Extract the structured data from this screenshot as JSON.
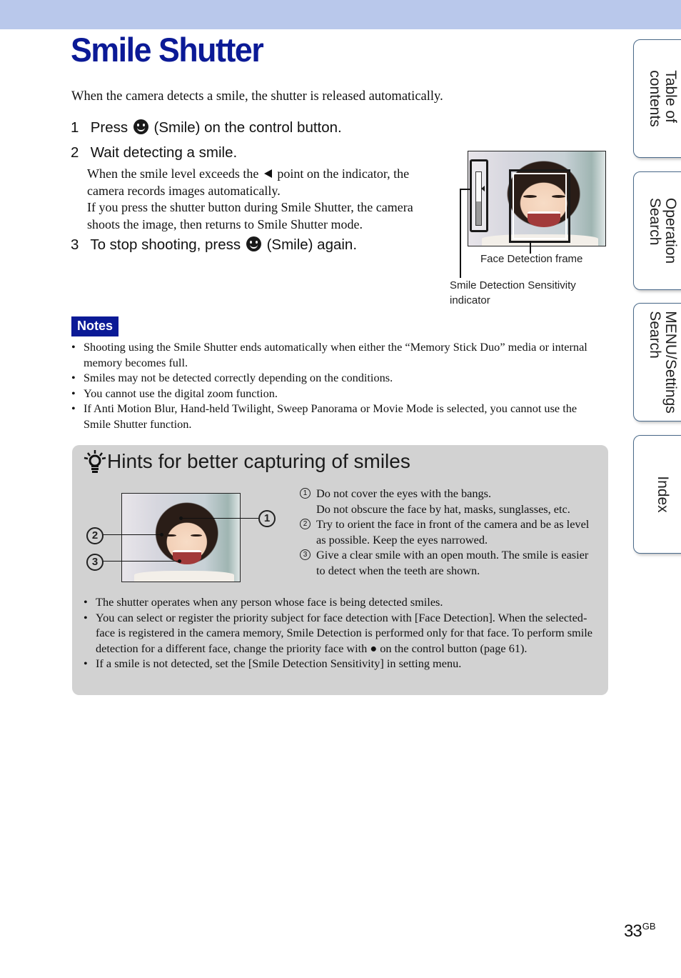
{
  "header": {
    "bar_color": "#b9c8eb"
  },
  "page_title": "Smile Shutter",
  "intro": "When the camera detects a smile, the shutter is released automatically.",
  "steps": [
    {
      "num": "1",
      "before": "Press",
      "icon": "smile-icon",
      "after": "(Smile) on the control button."
    },
    {
      "num": "2",
      "text": "Wait detecting a smile."
    },
    {
      "num": "3",
      "before": "To stop shooting, press",
      "icon": "smile-icon",
      "after": "(Smile) again."
    }
  ],
  "step2_body": {
    "line1_before": "When the smile level exceeds the",
    "line1_after": "point on the indicator, the camera records images automatically.",
    "line2": "If you press the shutter button during Smile Shutter, the camera shoots the image, then returns to Smile Shutter mode."
  },
  "figure": {
    "face_frame_caption": "Face Detection frame",
    "indicator_caption_1": "Smile Detection Sensitivity",
    "indicator_caption_2": "indicator",
    "indicator_level_fraction": 0.45
  },
  "notes": {
    "badge": "Notes",
    "items": [
      "Shooting using the Smile Shutter ends automatically when either the “Memory Stick Duo” media or internal memory becomes full.",
      "Smiles may not be detected correctly depending on the conditions.",
      "You cannot use the digital zoom function.",
      "If Anti Motion Blur, Hand-held Twilight, Sweep Panorama or Movie Mode is selected, you cannot use the Smile Shutter function."
    ]
  },
  "hints": {
    "title": "Hints for better capturing of smiles",
    "callouts": [
      "1",
      "2",
      "3"
    ],
    "items": [
      {
        "num": "1",
        "lines": [
          "Do not cover the eyes with the bangs.",
          "Do not obscure the face by hat, masks, sunglasses, etc."
        ]
      },
      {
        "num": "2",
        "lines": [
          "Try to orient the face in front of the camera and be as level as possible. Keep the eyes narrowed."
        ]
      },
      {
        "num": "3",
        "lines": [
          "Give a clear smile with an open mouth. The smile is easier to detect when the teeth are shown."
        ]
      }
    ],
    "bullets": [
      "The shutter operates when any person whose face is being detected smiles.",
      "You can select or register the priority subject for face detection with [Face Detection]. When the selected-face is registered in the camera memory, Smile Detection is performed only for that face. To perform smile detection for a different face, change the priority face with ● on the control button (page 61).",
      "If a smile is not detected, set the [Smile Detection Sensitivity] in setting menu."
    ]
  },
  "side_tabs": [
    {
      "line1": "Table of",
      "line2": "contents"
    },
    {
      "line1": "Operation",
      "line2": "Search"
    },
    {
      "line1": "MENU/Settings",
      "line2": "Search"
    },
    {
      "line1": "Index",
      "line2": ""
    }
  ],
  "page_number": {
    "num": "33",
    "suffix": "GB"
  }
}
